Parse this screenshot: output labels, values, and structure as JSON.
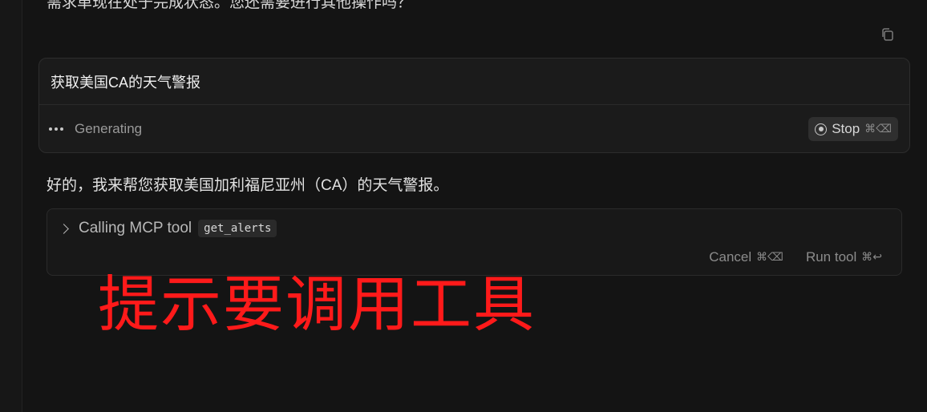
{
  "previous_message": "需求单现在处于完成状态。您还需要进行其他操作吗？",
  "composer": {
    "query": "获取美国CA的天气警报",
    "status": "Generating",
    "stop_label": "Stop",
    "stop_shortcut": "⌘⌫"
  },
  "reply": "好的，我来帮您获取美国加利福尼亚州（CA）的天气警报。",
  "tool_call": {
    "title": "Calling MCP tool",
    "tool_name": "get_alerts",
    "cancel_label": "Cancel",
    "cancel_shortcut": "⌘⌫",
    "run_label": "Run tool",
    "run_shortcut": "⌘↩"
  },
  "annotation": "提示要调用工具",
  "colors": {
    "background": "#141414",
    "annotation": "#ff1a1a"
  }
}
